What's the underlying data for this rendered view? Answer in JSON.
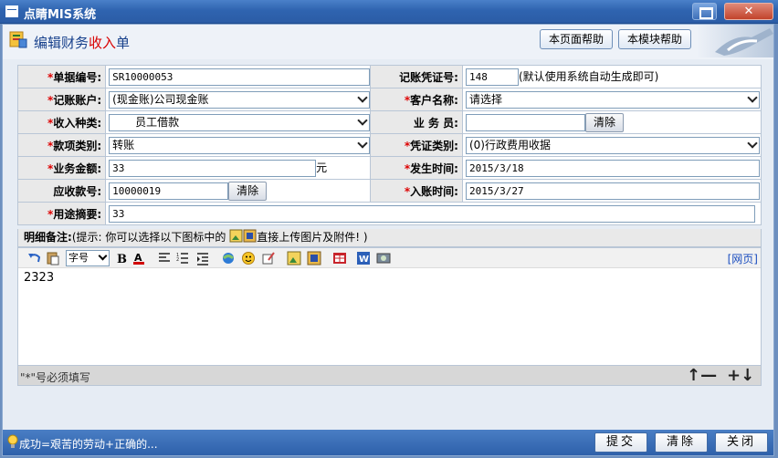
{
  "window": {
    "title": "点睛MIS系统"
  },
  "header": {
    "title_prefix": "编辑财务",
    "title_highlight": "收入",
    "title_suffix": "单",
    "help_page": "本页面帮助",
    "help_module": "本模块帮助"
  },
  "form": {
    "doc_no": {
      "label": "单据编号:",
      "value": "SR10000053"
    },
    "voucher_no": {
      "label": "记账凭证号:",
      "value": "148",
      "hint": "(默认使用系统自动生成即可)"
    },
    "account": {
      "label": "记账账户:",
      "value": "(现金账)公司现金账"
    },
    "customer": {
      "label": "客户名称:",
      "value": "请选择"
    },
    "income_type": {
      "label": "收入种类:",
      "value": "员工借款"
    },
    "clerk": {
      "label": "业 务 员:",
      "value": "",
      "clear": "清除"
    },
    "payment_type": {
      "label": "款项类别:",
      "value": "转账"
    },
    "voucher_type": {
      "label": "凭证类别:",
      "value": "(0)行政费用收据"
    },
    "amount": {
      "label": "业务金额:",
      "value": "33",
      "unit": "元"
    },
    "occur_time": {
      "label": "发生时间:",
      "value": "2015/3/18"
    },
    "receivable_no": {
      "label": "应收款号:",
      "value": "10000019",
      "clear": "清除"
    },
    "entry_time": {
      "label": "入账时间:",
      "value": "2015/3/27"
    },
    "purpose": {
      "label": "用途摘要:",
      "value": "33"
    },
    "required_mark": "*"
  },
  "notes": {
    "label": "明细备注:",
    "hint_before": "(提示: 你可以选择以下图标中的",
    "hint_after": "直接上传图片及附件! )",
    "font_size_label": "字号",
    "web_link": "[网页]",
    "content": "2323",
    "footnote": "\"*\"号必须填写",
    "shrink_label": "↑—",
    "expand_label": "+↓"
  },
  "status": {
    "text": "成功=艰苦的劳动+正确的..."
  },
  "footer": {
    "submit": "提交",
    "clear": "清除",
    "close": "关闭"
  }
}
